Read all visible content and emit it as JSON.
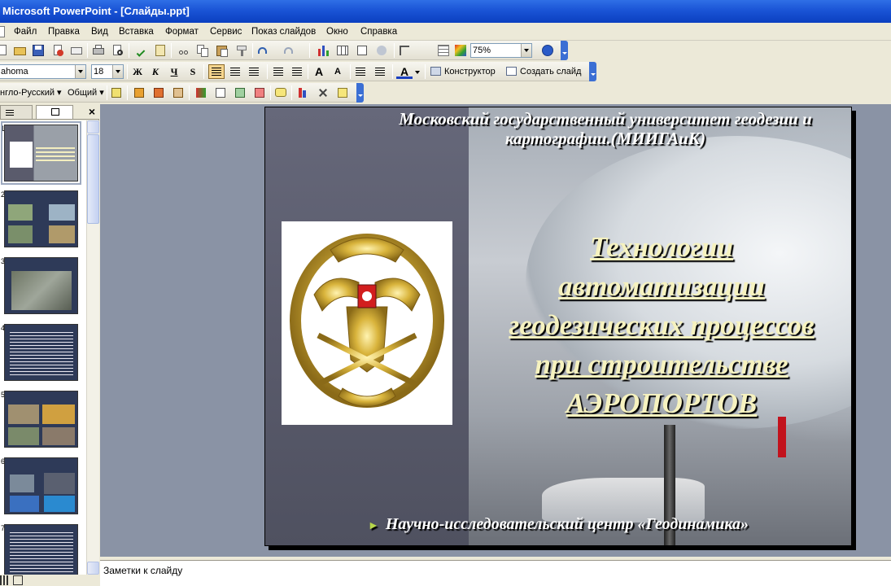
{
  "window": {
    "title": "Microsoft PowerPoint - [Слайды.ppt]"
  },
  "menu": [
    "Файл",
    "Правка",
    "Вид",
    "Вставка",
    "Формат",
    "Сервис",
    "Показ слайдов",
    "Окно",
    "Справка"
  ],
  "standard_toolbar": {
    "zoom": "75%"
  },
  "formatting_toolbar": {
    "font": "ahoma",
    "size": "18",
    "bold": "Ж",
    "italic": "К",
    "underline": "Ч",
    "shadow": "S",
    "font_grow": "A",
    "font_shrink": "A",
    "font_color": "A",
    "designer": "Конструктор",
    "new_slide": "Создать слайд"
  },
  "language_toolbar": {
    "language": "нгло-Русский",
    "general": "Общий"
  },
  "slides_pane": {
    "thumbnail_numbers": [
      "1",
      "2",
      "3",
      "4",
      "5",
      "6",
      "7"
    ]
  },
  "slide": {
    "university": "Московский государственный университет геодезии и картографии.(МИИГАиК)",
    "title_lines": [
      "Технологии",
      "автоматизации",
      "геодезических процессов",
      "при строительстве",
      "АЭРОПОРТОВ"
    ],
    "footer": "Научно-исследовательский центр «Геодинамика»"
  },
  "notes": {
    "placeholder": "Заметки к слайду"
  },
  "colors": {
    "titlebar": "#1a54d6",
    "slide_title": "#f6f2bf",
    "footer_bullet": "#b7d64a"
  }
}
